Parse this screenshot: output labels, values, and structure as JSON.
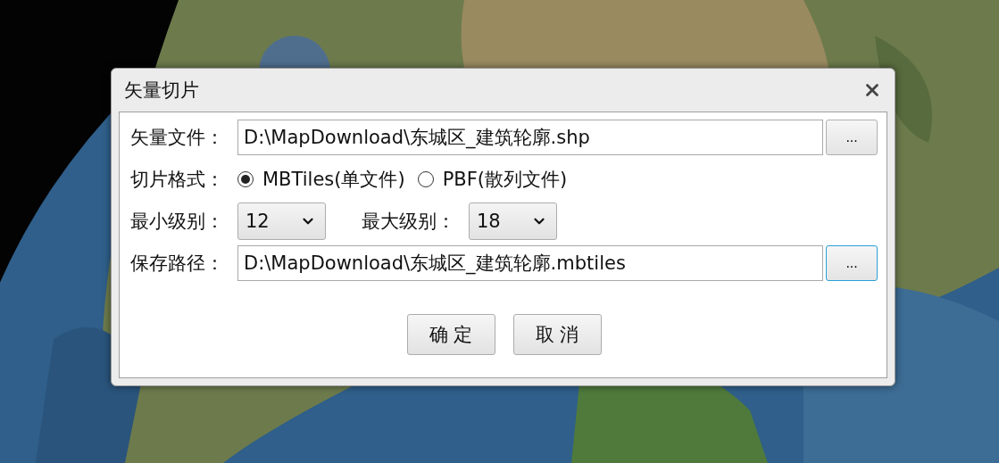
{
  "dialog": {
    "title": "矢量切片",
    "vector_file": {
      "label": "矢量文件：",
      "value": "D:\\MapDownload\\东城区_建筑轮廓.shp",
      "browse": {
        "label": "...",
        "focused": false
      }
    },
    "tile_format": {
      "label": "切片格式：",
      "options": [
        {
          "label": "MBTiles(单文件)",
          "selected": true
        },
        {
          "label": "PBF(散列文件)",
          "selected": false
        }
      ]
    },
    "min_level": {
      "label": "最小级别：",
      "value": "12"
    },
    "max_level": {
      "label": "最大级别：",
      "value": "18"
    },
    "save_path": {
      "label": "保存路径：",
      "value": "D:\\MapDownload\\东城区_建筑轮廓.mbtiles",
      "browse": {
        "label": "...",
        "focused": true
      }
    },
    "buttons": [
      "确 定",
      "取 消"
    ]
  }
}
